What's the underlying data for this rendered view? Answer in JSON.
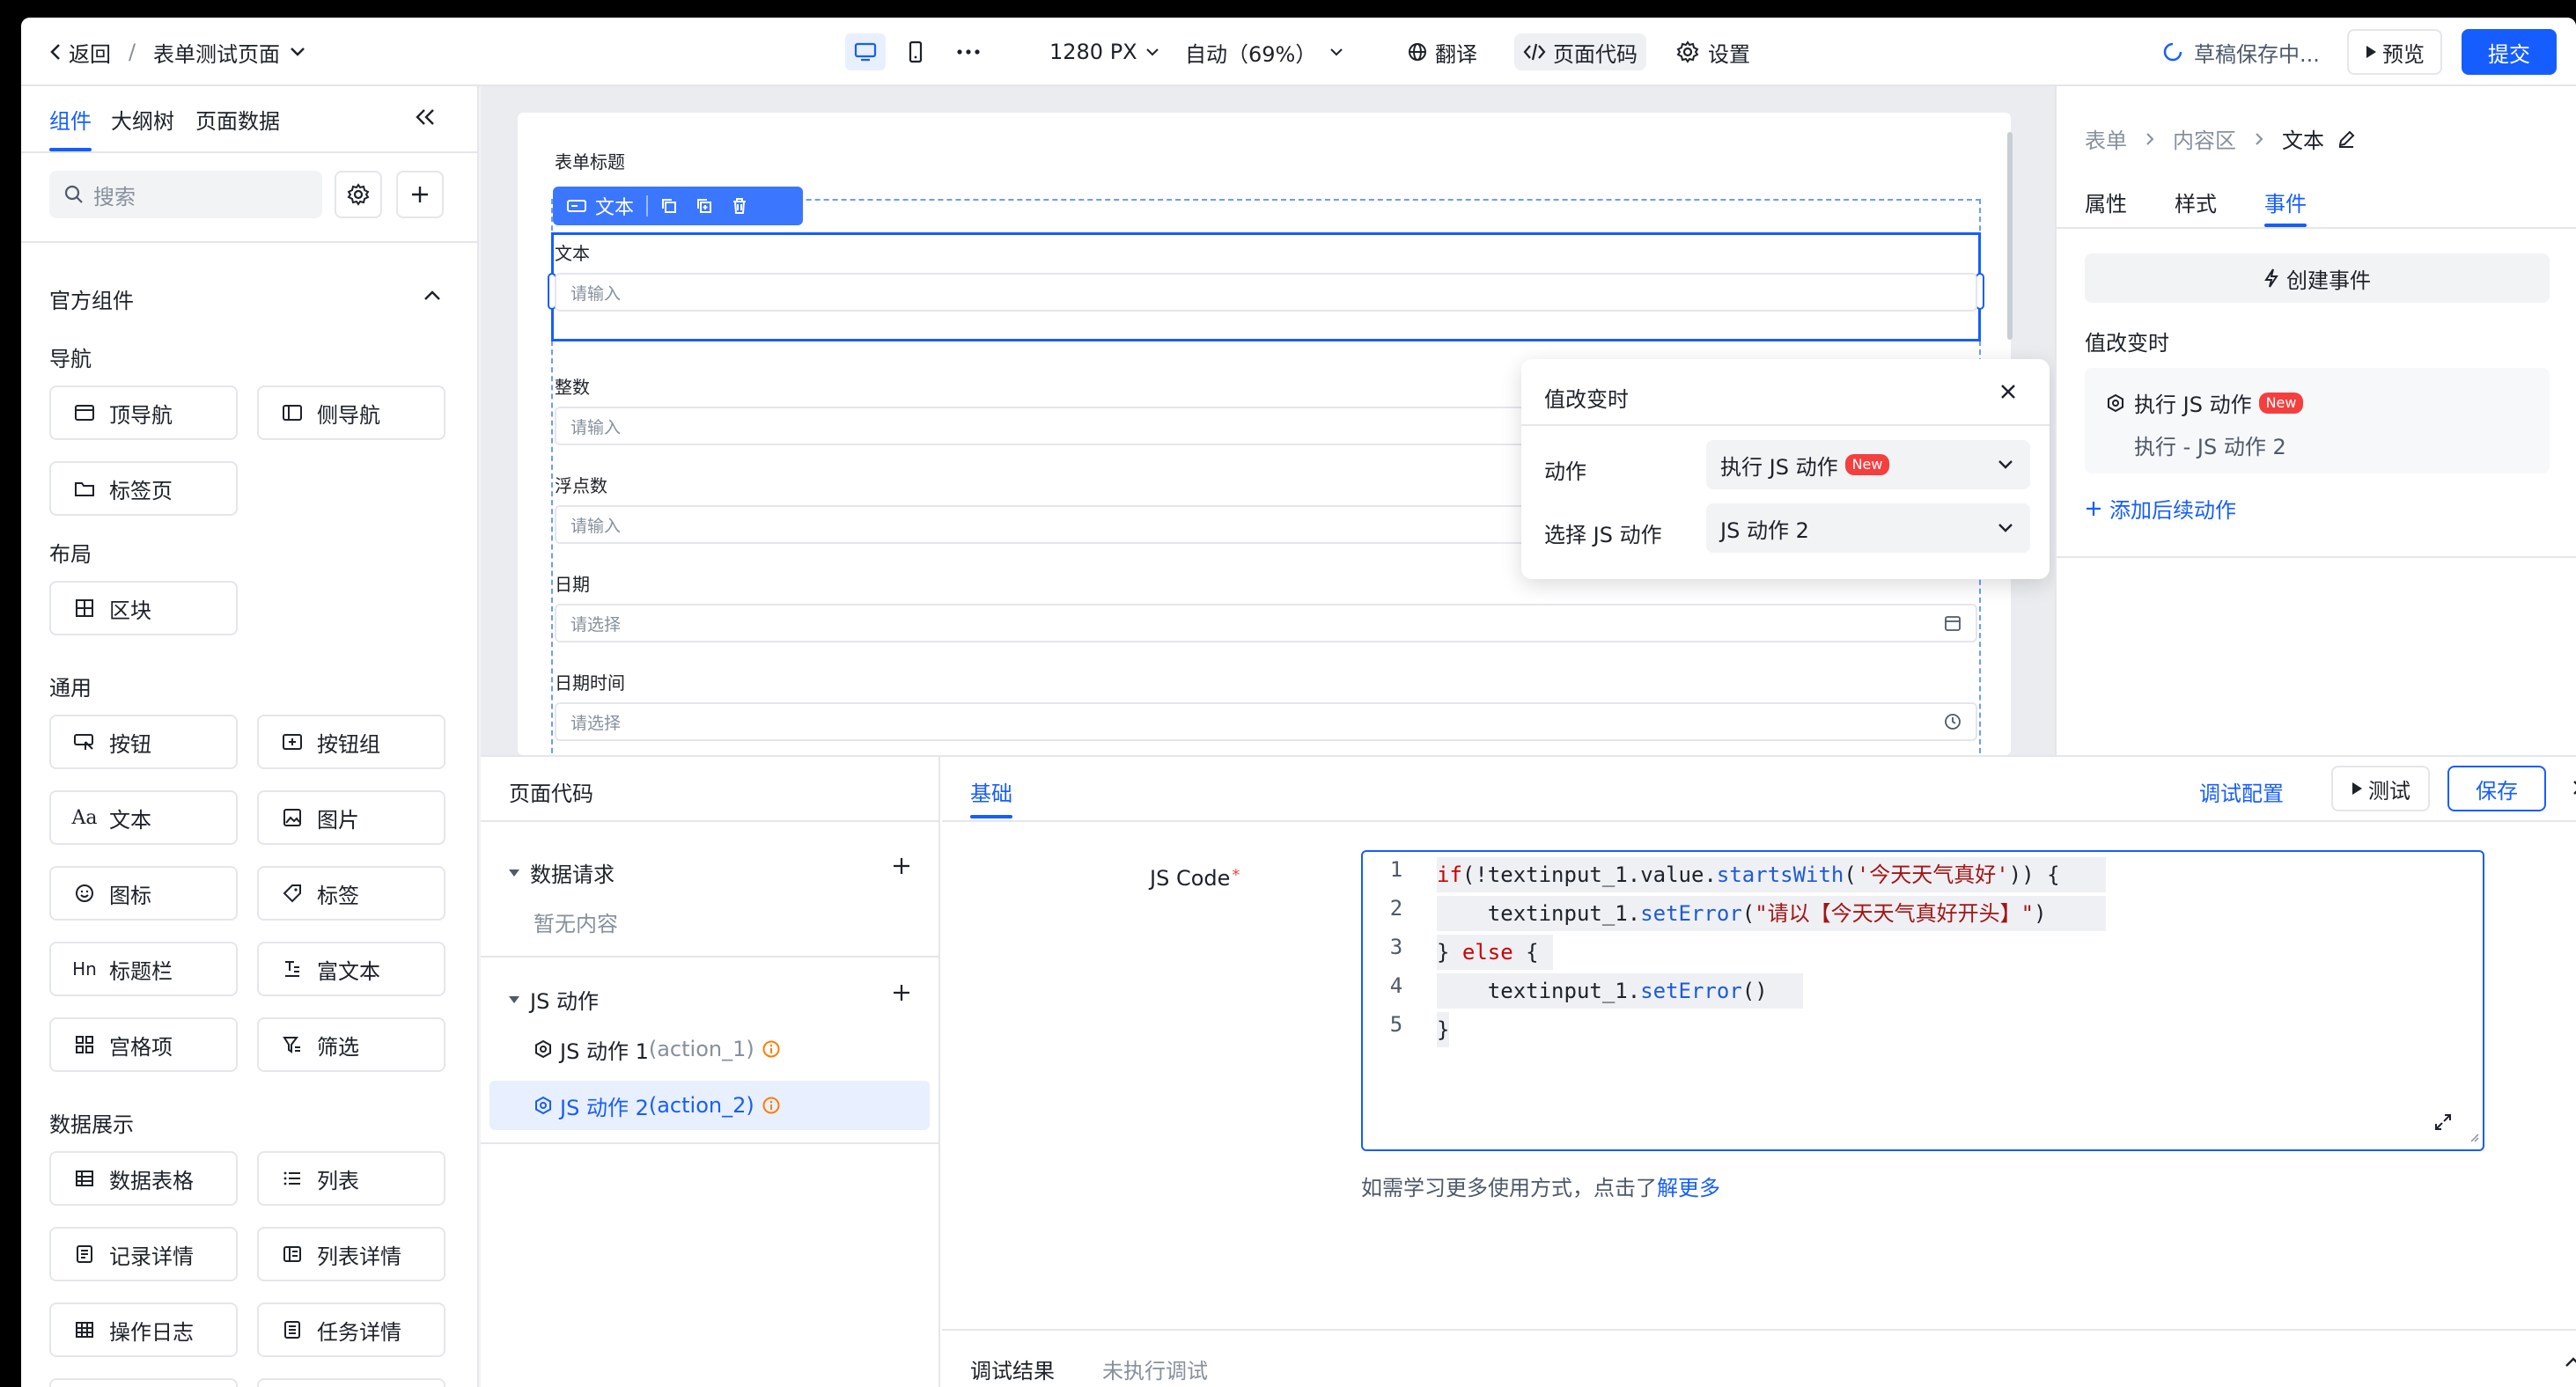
{
  "topbar": {
    "back_label": "返回",
    "separator": "/",
    "page_title": "表单测试页面",
    "width_value": "1280 PX",
    "zoom_value": "自动（69%）",
    "translate_label": "翻译",
    "page_code_label": "页面代码",
    "settings_label": "设置",
    "draft_status": "草稿保存中...",
    "preview_label": "预览",
    "submit_label": "提交"
  },
  "left": {
    "tabs": [
      "组件",
      "大纲树",
      "页面数据"
    ],
    "search_placeholder": "搜索",
    "section_title": "官方组件",
    "groups": {
      "nav": {
        "title": "导航",
        "items": [
          "顶导航",
          "侧导航",
          "标签页"
        ]
      },
      "layout": {
        "title": "布局",
        "items": [
          "区块"
        ]
      },
      "general": {
        "title": "通用",
        "items": [
          "按钮",
          "按钮组",
          "文本",
          "图片",
          "图标",
          "标签",
          "标题栏",
          "富文本",
          "宫格项",
          "筛选"
        ]
      },
      "display": {
        "title": "数据展示",
        "items": [
          "数据表格",
          "列表",
          "记录详情",
          "列表详情",
          "操作日志",
          "任务详情"
        ]
      }
    }
  },
  "canvas": {
    "form_title": "表单标题",
    "toolbar_label": "文本",
    "fields": [
      {
        "label": "文本",
        "placeholder": "请输入"
      },
      {
        "label": "整数",
        "placeholder": "请输入"
      },
      {
        "label": "浮点数",
        "placeholder": "请输入"
      },
      {
        "label": "日期",
        "placeholder": "请选择"
      },
      {
        "label": "日期时间",
        "placeholder": "请选择"
      }
    ]
  },
  "popup": {
    "title": "值改变时",
    "action_label": "动作",
    "action_value": "执行 JS 动作",
    "new_badge": "New",
    "select_label": "选择 JS 动作",
    "select_value": "JS 动作 2"
  },
  "right": {
    "breadcrumb": [
      "表单",
      "内容区",
      "文本"
    ],
    "tabs": [
      "属性",
      "样式",
      "事件"
    ],
    "create_event": "创建事件",
    "event_title": "值改变时",
    "event_action": "执行 JS 动作",
    "new_badge": "New",
    "event_detail": "执行 - JS 动作 2",
    "add_action": "添加后续动作"
  },
  "bottom": {
    "title": "页面代码",
    "data_request_label": "数据请求",
    "empty_text": "暂无内容",
    "js_actions_label": "JS 动作",
    "actions": [
      {
        "name": "JS 动作 1",
        "id": "(action_1)"
      },
      {
        "name": "JS 动作 2",
        "id": "(action_2)"
      }
    ],
    "tab_basic": "基础",
    "debug_config": "调试配置",
    "test_label": "测试",
    "save_label": "保存",
    "js_code_label": "JS Code",
    "required_mark": "*",
    "code_lines": [
      [
        "1",
        "if(!textinput_1.value.startsWith('今天天气真好')) {"
      ],
      [
        "2",
        "    textinput_1.setError(\"请以【今天天气真好开头】\")"
      ],
      [
        "3",
        "} else {"
      ],
      [
        "4",
        "    textinput_1.setError()"
      ],
      [
        "5",
        "}"
      ]
    ],
    "help_prefix": "如需学习更多使用方式，点击了",
    "help_link": "解更多",
    "debug_result_label": "调试结果",
    "debug_result_value": "未执行调试"
  },
  "colors": {
    "primary": "#165dff",
    "danger": "#f53f3f",
    "warning": "#ff7d00"
  }
}
